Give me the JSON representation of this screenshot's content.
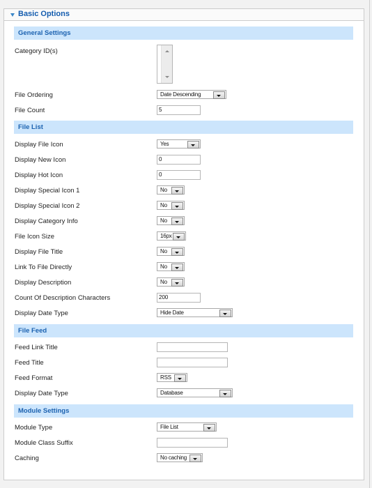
{
  "panel": {
    "title": "Basic Options",
    "collapse_icon": "triangle-down-icon"
  },
  "sections": {
    "general": {
      "title": "General Settings",
      "category_ids_label": "Category ID(s)",
      "file_ordering_label": "File Ordering",
      "file_ordering_value": "Date Descending",
      "file_count_label": "File Count",
      "file_count_value": "5"
    },
    "file_list": {
      "title": "File List",
      "display_file_icon_label": "Display File Icon",
      "display_file_icon_value": "Yes",
      "display_new_icon_label": "Display New Icon",
      "display_new_icon_value": "0",
      "display_hot_icon_label": "Display Hot Icon",
      "display_hot_icon_value": "0",
      "display_special_icon_1_label": "Display Special Icon 1",
      "display_special_icon_1_value": "No",
      "display_special_icon_2_label": "Display Special Icon 2",
      "display_special_icon_2_value": "No",
      "display_category_info_label": "Display Category Info",
      "display_category_info_value": "No",
      "file_icon_size_label": "File Icon Size",
      "file_icon_size_value": "16px",
      "display_file_title_label": "Display File Title",
      "display_file_title_value": "No",
      "link_to_file_directly_label": "Link To File Directly",
      "link_to_file_directly_value": "No",
      "display_description_label": "Display Description",
      "display_description_value": "No",
      "count_desc_chars_label": "Count Of Description Characters",
      "count_desc_chars_value": "200",
      "display_date_type_label": "Display Date Type",
      "display_date_type_value": "Hide Date"
    },
    "file_feed": {
      "title": "File Feed",
      "feed_link_title_label": "Feed Link Title",
      "feed_link_title_value": "",
      "feed_title_label": "Feed Title",
      "feed_title_value": "",
      "feed_format_label": "Feed Format",
      "feed_format_value": "RSS",
      "display_date_type_label": "Display Date Type",
      "display_date_type_value": "Database"
    },
    "module": {
      "title": "Module Settings",
      "module_type_label": "Module Type",
      "module_type_value": "File List",
      "module_class_suffix_label": "Module Class Suffix",
      "module_class_suffix_value": "",
      "caching_label": "Caching",
      "caching_value": "No caching"
    }
  }
}
